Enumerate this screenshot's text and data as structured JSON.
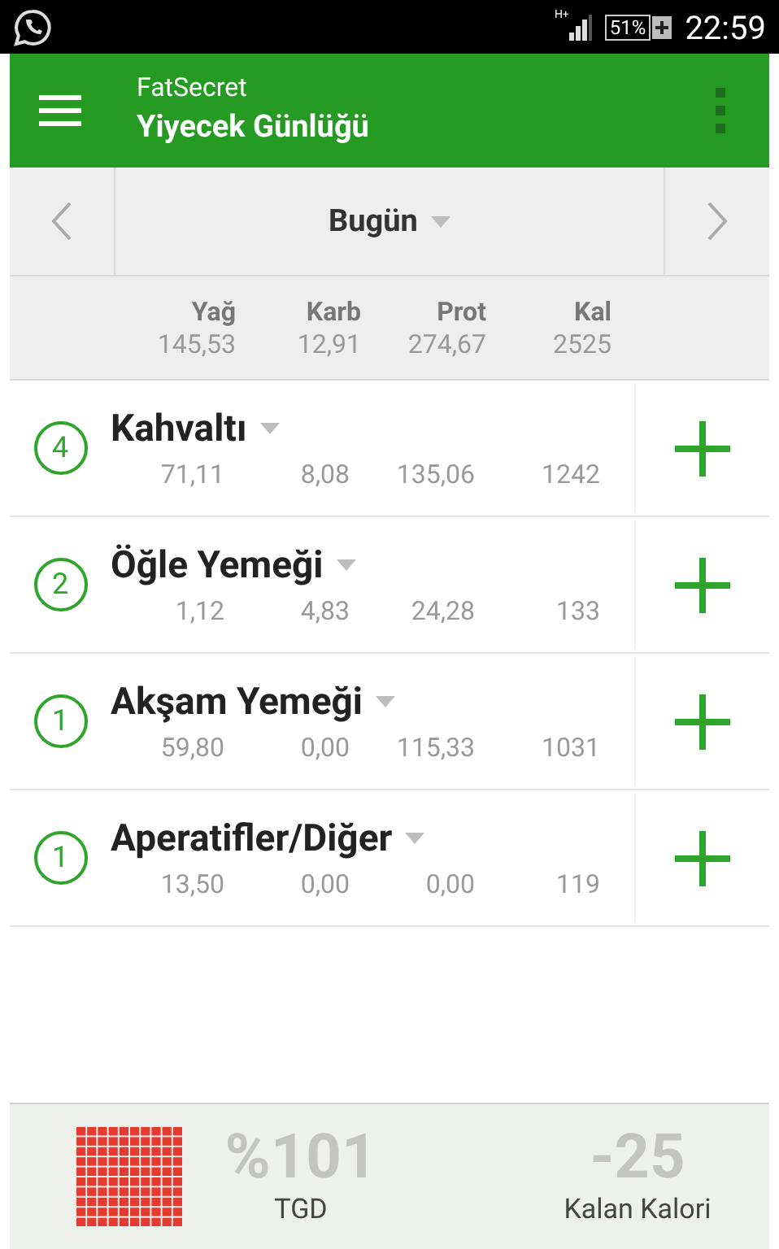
{
  "status_bar": {
    "network": "H+",
    "battery": "51%",
    "time": "22:59"
  },
  "app_bar": {
    "app_name": "FatSecret",
    "title": "Yiyecek Günlüğü"
  },
  "date_nav": {
    "label": "Bugün"
  },
  "totals": {
    "columns": [
      {
        "label": "Yağ",
        "value": "145,53"
      },
      {
        "label": "Karb",
        "value": "12,91"
      },
      {
        "label": "Prot",
        "value": "274,67"
      },
      {
        "label": "Kal",
        "value": "2525"
      }
    ]
  },
  "meals": [
    {
      "count": "4",
      "name": "Kahvaltı",
      "values": [
        "71,11",
        "8,08",
        "135,06",
        "1242"
      ]
    },
    {
      "count": "2",
      "name": "Öğle Yemeği",
      "values": [
        "1,12",
        "4,83",
        "24,28",
        "133"
      ]
    },
    {
      "count": "1",
      "name": "Akşam Yemeği",
      "values": [
        "59,80",
        "0,00",
        "115,33",
        "1031"
      ]
    },
    {
      "count": "1",
      "name": "Aperatifler/Diğer",
      "values": [
        "13,50",
        "0,00",
        "0,00",
        "119"
      ]
    }
  ],
  "summary": {
    "rdi_value": "%101",
    "rdi_label": "TGD",
    "remaining_value": "-25",
    "remaining_label": "Kalan Kalori"
  }
}
